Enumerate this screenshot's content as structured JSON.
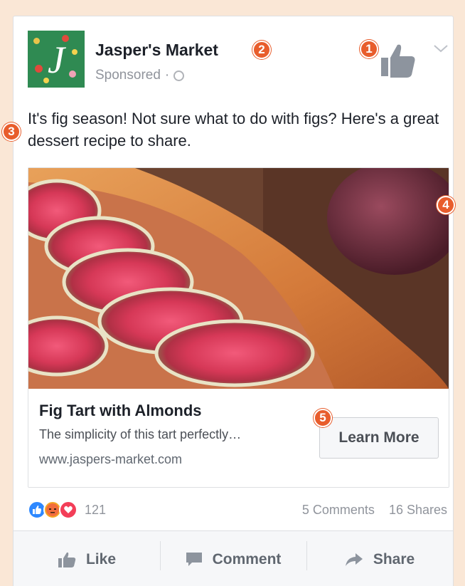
{
  "post": {
    "page_name": "Jasper's Market",
    "sponsored_label": "Sponsored",
    "separator": "·",
    "text": "It's fig season! Not sure what to do with figs? Here's a great dessert recipe to share."
  },
  "link": {
    "title": "Fig Tart with Almonds",
    "description": "The simplicity of this tart perfectly…",
    "url": "www.jaspers-market.com",
    "cta_label": "Learn More"
  },
  "engagement": {
    "reaction_count": "121",
    "comments": "5 Comments",
    "shares": "16 Shares"
  },
  "actions": {
    "like": "Like",
    "comment": "Comment",
    "share": "Share"
  },
  "callouts": [
    "1",
    "2",
    "3",
    "4",
    "5"
  ],
  "colors": {
    "callout": "#e85d2c",
    "like_blue": "#2d88ff",
    "love_red": "#f33e58",
    "angry": "#f5a623",
    "background": "#fae7d6"
  }
}
